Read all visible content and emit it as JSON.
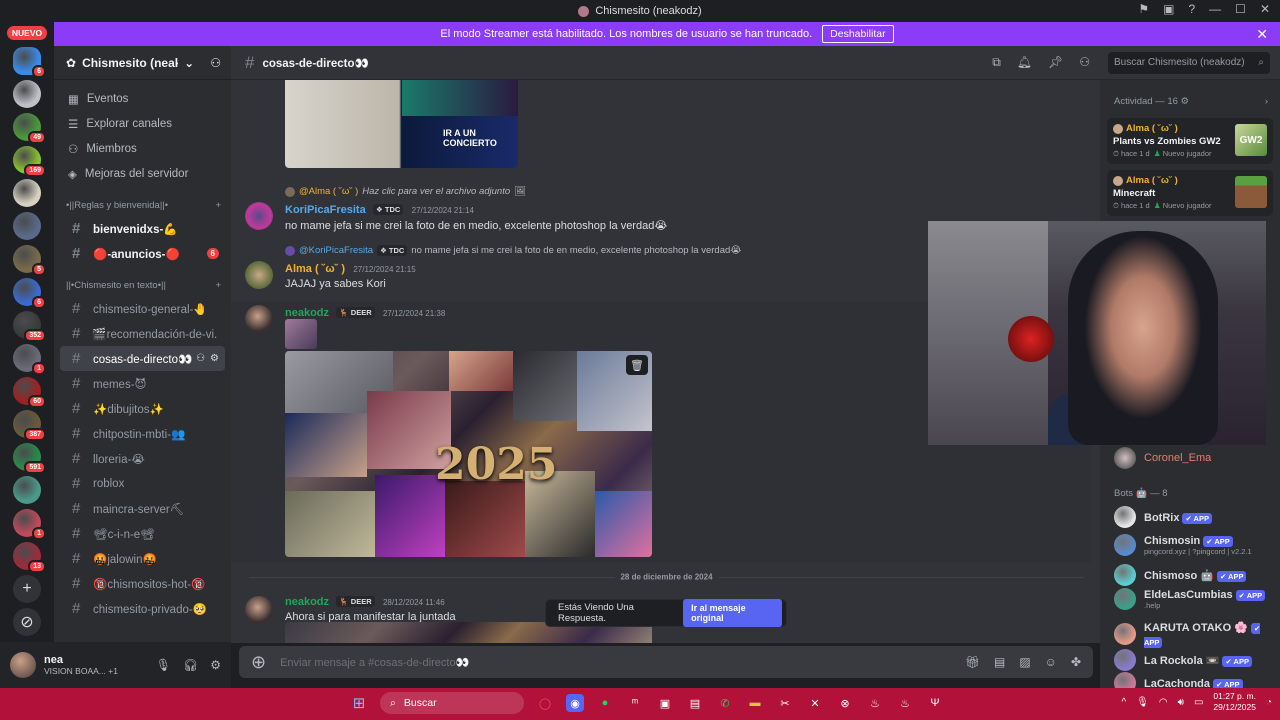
{
  "window": {
    "title": "Chismesito (neakodz)"
  },
  "streamer_banner": {
    "text": "El modo Streamer está habilitado. Los nombres de usuario se han truncado.",
    "button": "Deshabilitar"
  },
  "guilds": {
    "new_label": "NUEVO",
    "badges": [
      "6",
      "",
      "49",
      "169",
      "",
      "",
      "5",
      "6",
      "352",
      "1",
      "60",
      "387",
      "591",
      "",
      "1",
      "13"
    ]
  },
  "server": {
    "name": "Chismesito (neak...",
    "nav": [
      "Eventos",
      "Explorar canales",
      "Miembros",
      "Mejoras del servidor"
    ],
    "categories": [
      "•||Reglas y bienvenida||•",
      "||•Chismesito en texto•||"
    ],
    "channels_rules": [
      {
        "name": "bienvenidxs-💪",
        "unread": true
      },
      {
        "name": "🔴-anuncios-🔴",
        "unread": true,
        "count": "6"
      }
    ],
    "channels_text": [
      {
        "name": "chismesito-general-🤚"
      },
      {
        "name": "🎬recomendación-de-vi..."
      },
      {
        "name": "cosas-de-directo👀",
        "active": true
      },
      {
        "name": "memes-😈"
      },
      {
        "name": "✨dibujitos✨"
      },
      {
        "name": "chitpostin-mbti-👥"
      },
      {
        "name": "lloreria-😭"
      },
      {
        "name": "roblox"
      },
      {
        "name": "maincra-server⛏"
      },
      {
        "name": "📽c-i-n-e📽"
      },
      {
        "name": "🤬jalowin🤬"
      },
      {
        "name": "🔞chismositos-hot-🔞"
      },
      {
        "name": "chismesito-privado-🥺"
      }
    ]
  },
  "user": {
    "name": "nea",
    "status": "VISION BOAA... +1"
  },
  "chat_header": {
    "channel": "cosas-de-directo👀"
  },
  "search": {
    "placeholder": "Buscar Chismesito (neakodz)"
  },
  "messages": {
    "m1": {
      "reply_author": "@Alma ( ˘ω˘ )",
      "reply_text": "Haz clic para ver el archivo adjunto",
      "author": "KoriPicaFresita",
      "tag": "TDC",
      "time": "27/12/2024 21:14",
      "text": "no mame jefa si me crei la foto de en medio, excelente photoshop la verdad😭"
    },
    "m2": {
      "reply_author": "@KoriPicaFresita",
      "reply_tag": "TDC",
      "reply_text": "no mame jefa si me crei la foto de en medio, excelente photoshop la verdad😭",
      "author": "Alma ( ˘ω˘ )",
      "time": "27/12/2024 21:15",
      "text": "JAJAJ ya sabes Kori"
    },
    "m3": {
      "author": "neakodz",
      "tag": "DEER",
      "time": "27/12/2024 21:38",
      "collage_text": "2025"
    },
    "date_divider": "28 de diciembre de 2024",
    "m4": {
      "author": "neakodz",
      "tag": "DEER",
      "time": "28/12/2024 11:46",
      "text": "Ahora si para manifestar la juntada"
    },
    "old_image_text": [
      "IR A UN",
      "CONCIERTO"
    ]
  },
  "toast": {
    "text": "Estás Viendo Una Respuesta.",
    "button": "Ir al mensaje original"
  },
  "composer": {
    "placeholder": "Enviar mensaje a #cosas-de-directo👀"
  },
  "members": {
    "activity_header": "Actividad — 16",
    "activities": [
      {
        "who": "Alma ( ˘ω˘ )",
        "game": "Plants vs Zombies GW2",
        "ago": "hace 1 d",
        "note": "Nuevo jugador",
        "thumb_text": "GW2"
      },
      {
        "who": "Alma ( ˘ω˘ )",
        "game": "Minecraft",
        "ago": "hace 1 d",
        "note": "Nuevo jugador"
      }
    ],
    "member_visible": "Coronel_Ema",
    "bots_header": "Bots 🤖 — 8",
    "bots": [
      {
        "name": "BotRix",
        "sub": ""
      },
      {
        "name": "Chismosin",
        "sub": "pingcord.xyz | ?pingcord | v2.2.1"
      },
      {
        "name": "Chismoso 🤖",
        "sub": ""
      },
      {
        "name": "EldeLasCumbias",
        "sub": ".help"
      },
      {
        "name": "KARUTA OTAKO 🌸",
        "sub": ""
      },
      {
        "name": "La Rockola 📼",
        "sub": ""
      },
      {
        "name": "LaCachonda",
        "sub": ""
      }
    ],
    "app_label": "✔ APP"
  },
  "taskbar": {
    "search": "Buscar",
    "time": "01:27 p. m.",
    "date": "29/12/2025"
  },
  "colors": {
    "accent": "#5865f2",
    "streamer": "#8b3cf7",
    "taskbar": "#b2123a"
  }
}
